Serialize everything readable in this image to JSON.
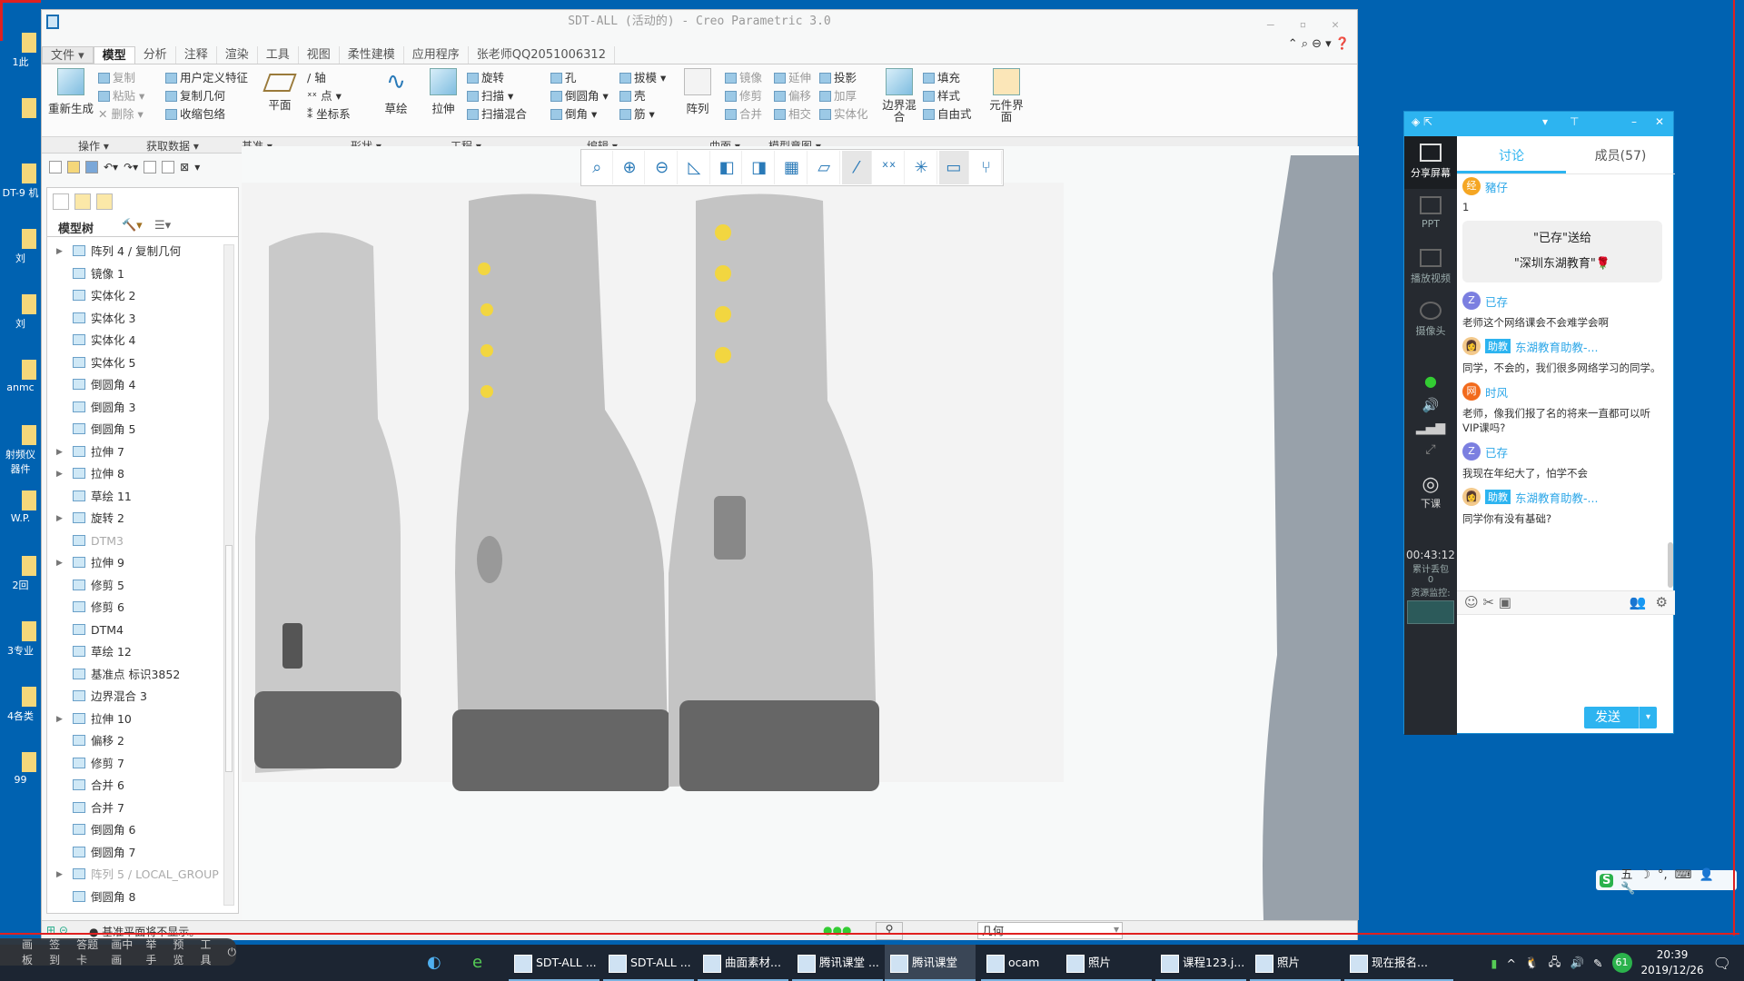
{
  "desktop": {
    "icons": [
      "1此",
      "",
      "DT-9 机",
      "刘",
      "刘",
      "anmc",
      "射频仪 器件",
      "W.P.",
      "2回",
      "3专业",
      "4各类",
      "99"
    ]
  },
  "window": {
    "title": "SDT-ALL (活动的) - Creo Parametric 3.0",
    "tabs": [
      "文件 ▾",
      "模型",
      "分析",
      "注释",
      "渲染",
      "工具",
      "视图",
      "柔性建模",
      "应用程序",
      "张老师QQ2051006312"
    ],
    "active_tab": "模型",
    "ribbon": {
      "regenerate": "重新生成",
      "copy": "复制",
      "paste": "粘贴",
      "delete": "删除",
      "udf": "用户定义特征",
      "copy_geom": "复制几何",
      "shrinkwrap": "收缩包络",
      "plane": "平面",
      "axis": "轴",
      "point": "点",
      "csys": "坐标系",
      "sketch": "草绘",
      "extrude": "拉伸",
      "revolve": "旋转",
      "sweep": "扫描",
      "swept_blend": "扫描混合",
      "hole": "孔",
      "round": "倒圆角",
      "chamfer": "倒角",
      "draft": "拔模",
      "shell": "壳",
      "rib": "筋",
      "pattern": "阵列",
      "mirror": "镜像",
      "extend": "延伸",
      "project": "投影",
      "trim": "修剪",
      "offset": "偏移",
      "thicken": "加厚",
      "merge": "合并",
      "intersect": "相交",
      "solidify": "实体化",
      "boundary_blend": "边界混合",
      "fill": "填充",
      "style": "样式",
      "freestyle": "自由式",
      "component_interface": "元件界面"
    },
    "groups": [
      "操作 ▾",
      "获取数据 ▾",
      "基准 ▾",
      "形状 ▾",
      "工程 ▾",
      "编辑 ▾",
      "曲面 ▾",
      "模型意图 ▾"
    ]
  },
  "model_tree": {
    "title": "模型树",
    "items": [
      {
        "label": "阵列 4 / 复制几何",
        "expand": true,
        "dim": false
      },
      {
        "label": "镜像 1",
        "expand": false,
        "dim": false
      },
      {
        "label": "实体化 2",
        "expand": false,
        "dim": false
      },
      {
        "label": "实体化 3",
        "expand": false,
        "dim": false
      },
      {
        "label": "实体化 4",
        "expand": false,
        "dim": false
      },
      {
        "label": "实体化 5",
        "expand": false,
        "dim": false
      },
      {
        "label": "倒圆角 4",
        "expand": false,
        "dim": false
      },
      {
        "label": "倒圆角 3",
        "expand": false,
        "dim": false
      },
      {
        "label": "倒圆角 5",
        "expand": false,
        "dim": false
      },
      {
        "label": "拉伸 7",
        "expand": true,
        "dim": false
      },
      {
        "label": "拉伸 8",
        "expand": true,
        "dim": false
      },
      {
        "label": "草绘 11",
        "expand": false,
        "dim": false
      },
      {
        "label": "旋转 2",
        "expand": true,
        "dim": false
      },
      {
        "label": "DTM3",
        "expand": false,
        "dim": true
      },
      {
        "label": "拉伸 9",
        "expand": true,
        "dim": false
      },
      {
        "label": "修剪 5",
        "expand": false,
        "dim": false
      },
      {
        "label": "修剪 6",
        "expand": false,
        "dim": false
      },
      {
        "label": "DTM4",
        "expand": false,
        "dim": false
      },
      {
        "label": "草绘 12",
        "expand": false,
        "dim": false
      },
      {
        "label": "基准点 标识3852",
        "expand": false,
        "dim": false
      },
      {
        "label": "边界混合 3",
        "expand": false,
        "dim": false
      },
      {
        "label": "拉伸 10",
        "expand": true,
        "dim": false
      },
      {
        "label": "偏移 2",
        "expand": false,
        "dim": false
      },
      {
        "label": "修剪 7",
        "expand": false,
        "dim": false
      },
      {
        "label": "合并 6",
        "expand": false,
        "dim": false
      },
      {
        "label": "合并 7",
        "expand": false,
        "dim": false
      },
      {
        "label": "倒圆角 6",
        "expand": false,
        "dim": false
      },
      {
        "label": "倒圆角 7",
        "expand": false,
        "dim": false
      },
      {
        "label": "阵列 5 / LOCAL_GROUP",
        "expand": true,
        "dim": true
      },
      {
        "label": "倒圆角 8",
        "expand": false,
        "dim": false
      }
    ]
  },
  "graphics_toolbar": [
    "refit-icon",
    "zoom-in-icon",
    "zoom-out-icon",
    "repaint-icon",
    "display-style-icon",
    "saved-views-icon",
    "view-manager-icon",
    "plane-display-icon",
    "axis-display-icon",
    "point-display-icon",
    "csys-display-icon",
    "annotation-display-icon",
    "spin-center-icon"
  ],
  "status": {
    "message": "● 基准平面将不显示。",
    "filter": "几何"
  },
  "chat": {
    "tabs": [
      "讨论",
      "成员(57)"
    ],
    "sidebar": [
      "分享屏幕",
      "PPT",
      "播放视频",
      "摄像头",
      "下课"
    ],
    "timer": "00:43:12",
    "loss_label": "累计丢包",
    "loss_value": "0",
    "monitor_label": "资源监控:",
    "messages": [
      {
        "avatar": "经",
        "name": "豬仔",
        "text": "1",
        "color": "#f5a623"
      },
      {
        "gift_line1": "\"已存\"送给",
        "gift_line2": "\"深圳东湖教育\"🌹"
      },
      {
        "avatar": "Z",
        "name": "已存",
        "text": "老师这个网络课会不会难学会啊",
        "color": "#7b7fe0"
      },
      {
        "avatar": "👩",
        "badge": "助教",
        "name": "东湖教育助教-...",
        "text": "同学，不会的，我们很多网络学习的同学。",
        "color": "#f3c98b"
      },
      {
        "avatar": "网",
        "name": "时风",
        "text": "老师，像我们报了名的将来一直都可以听VIP课吗?",
        "color": "#f26b1d"
      },
      {
        "avatar": "Z",
        "name": "已存",
        "text": "我现在年纪大了，怕学不会",
        "color": "#7b7fe0"
      },
      {
        "avatar": "👩",
        "badge": "助教",
        "name": "东湖教育助教-...",
        "text": "同学你有没有基础?",
        "color": "#f3c98b"
      }
    ],
    "input_value": "",
    "send": "发送"
  },
  "teach_bar": [
    "画板",
    "签到",
    "答题卡",
    "画中画",
    "举手",
    "预览",
    "工具"
  ],
  "taskbar": {
    "items": [
      "SDT-ALL ...",
      "SDT-ALL ...",
      "曲面素材...",
      "腾讯课堂 ...",
      "腾讯课堂",
      "ocam",
      "照片",
      "课程123.j...",
      "照片",
      "现在报名..."
    ],
    "time": "20:39",
    "date": "2019/12/26",
    "badge": "61"
  },
  "ime": [
    "五",
    "☽",
    "°,",
    "⌨",
    "👤",
    "🔧"
  ]
}
